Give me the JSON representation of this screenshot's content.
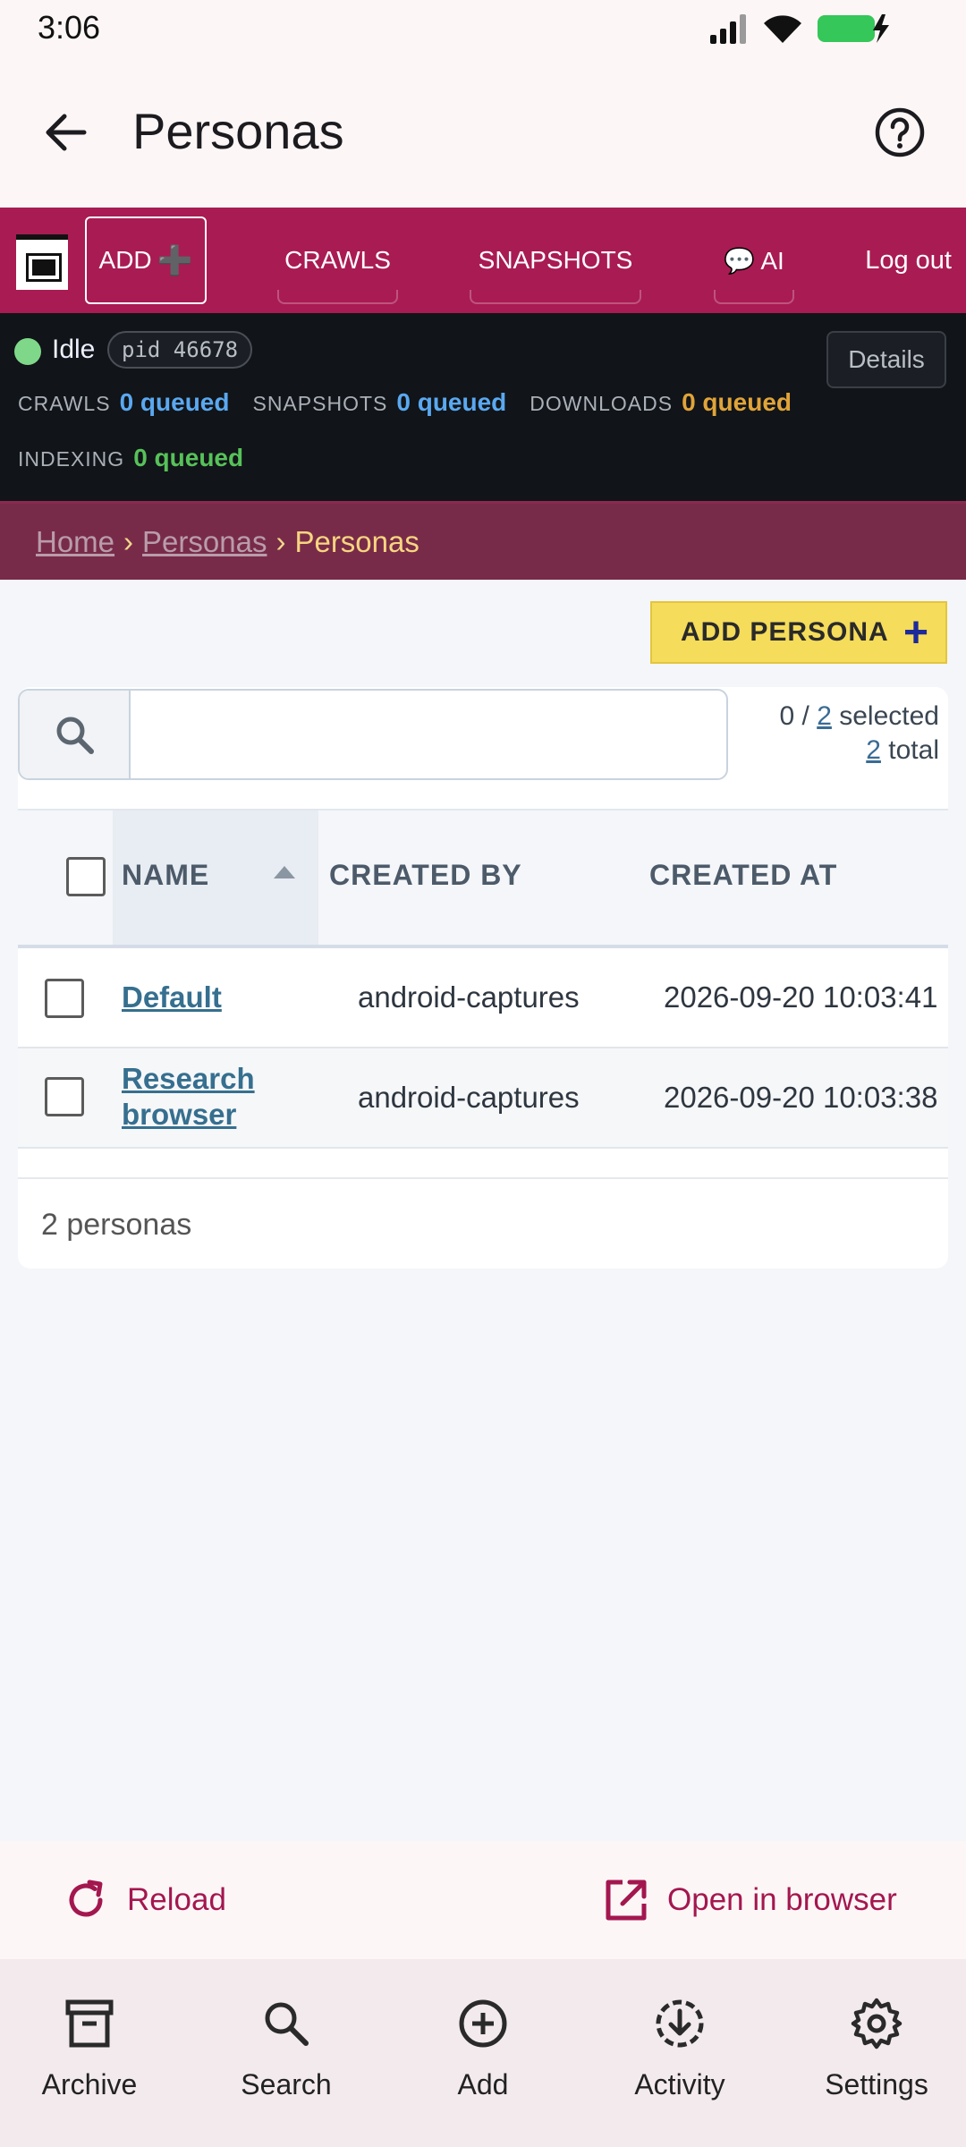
{
  "status_bar": {
    "time": "3:06"
  },
  "app_bar": {
    "title": "Personas"
  },
  "nav": {
    "add_label": "ADD",
    "add_plus": "➕",
    "links": [
      "CRAWLS",
      "SNAPSHOTS",
      "💬 AI"
    ],
    "logout": "Log out"
  },
  "status_panel": {
    "state": "Idle",
    "pid": "pid 46678",
    "details": "Details",
    "queues": [
      {
        "label": "CRAWLS",
        "value": "0 queued",
        "color": "#5aa8f0"
      },
      {
        "label": "SNAPSHOTS",
        "value": "0 queued",
        "color": "#5aa8f0"
      },
      {
        "label": "DOWNLOADS",
        "value": "0 queued",
        "color": "#e0a43a"
      },
      {
        "label": "INDEXING",
        "value": "0 queued",
        "color": "#57c15a"
      }
    ]
  },
  "breadcrumb": {
    "home": "Home",
    "section": "Personas",
    "current": "Personas",
    "sep": "›"
  },
  "toolbar": {
    "add_persona": "ADD PERSONA",
    "add_plus": "+"
  },
  "selection": {
    "selected": "0",
    "sep": " / ",
    "of": "2",
    "selected_word": "selected",
    "total": "2",
    "total_word": "total"
  },
  "table": {
    "columns": [
      "NAME",
      "CREATED BY",
      "CREATED AT"
    ],
    "rows": [
      {
        "name": "Default",
        "created_by": "android-captures",
        "created_at": "2026-09-20 10:03:41"
      },
      {
        "name_line1": "Research",
        "name_line2": "browser",
        "created_by": "android-captures",
        "created_at": "2026-09-20 10:03:38"
      }
    ],
    "footer": "2 personas"
  },
  "actions": {
    "reload": "Reload",
    "open_browser": "Open in browser"
  },
  "bottom_nav": [
    "Archive",
    "Search",
    "Add",
    "Activity",
    "Settings"
  ],
  "colors": {
    "brand": "#a91b53",
    "accent_yellow": "#f5dc5a",
    "action_text": "#a3174f"
  }
}
